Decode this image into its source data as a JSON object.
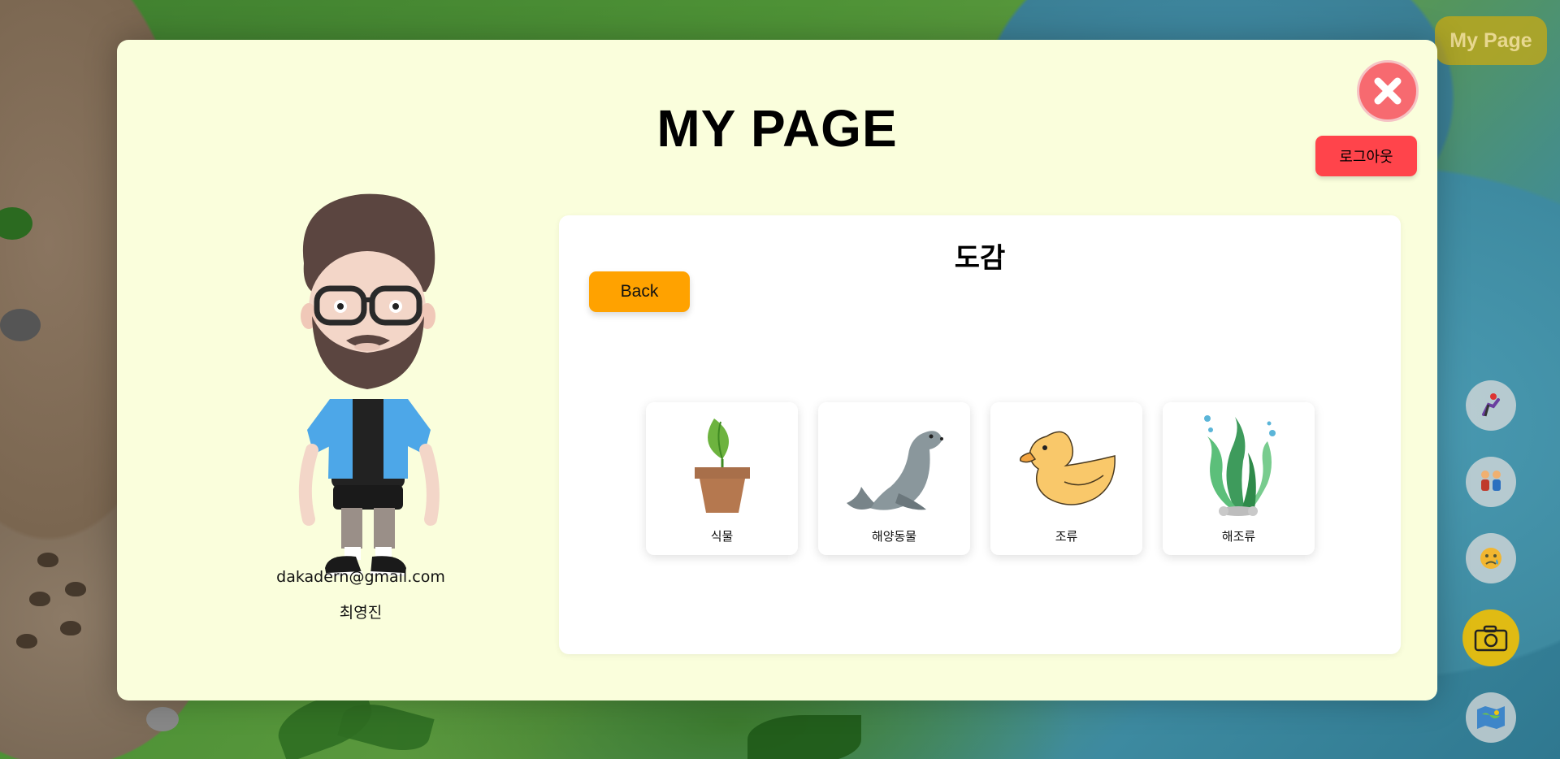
{
  "hud": {
    "my_page_label": "My Page",
    "tools": [
      {
        "icon": "dance-icon"
      },
      {
        "icon": "friends-icon"
      },
      {
        "icon": "emoji-icon"
      },
      {
        "icon": "camera-icon",
        "active": true
      },
      {
        "icon": "map-icon"
      }
    ]
  },
  "modal": {
    "title": "MY PAGE",
    "logout_label": "로그아웃",
    "profile": {
      "email": "dakadern@gmail.com",
      "name": "최영진"
    },
    "encyclopedia": {
      "title": "도감",
      "back_label": "Back",
      "categories": [
        {
          "label": "식물",
          "icon": "plant-pot-icon"
        },
        {
          "label": "해양동물",
          "icon": "seal-icon"
        },
        {
          "label": "조류",
          "icon": "duck-icon"
        },
        {
          "label": "해조류",
          "icon": "seaweed-icon"
        }
      ]
    }
  },
  "colors": {
    "modal_bg": "#fafedc",
    "close": "#f76a70",
    "logout": "#ff444b",
    "back": "#ffa200",
    "camera_active": "#e0bb13"
  }
}
